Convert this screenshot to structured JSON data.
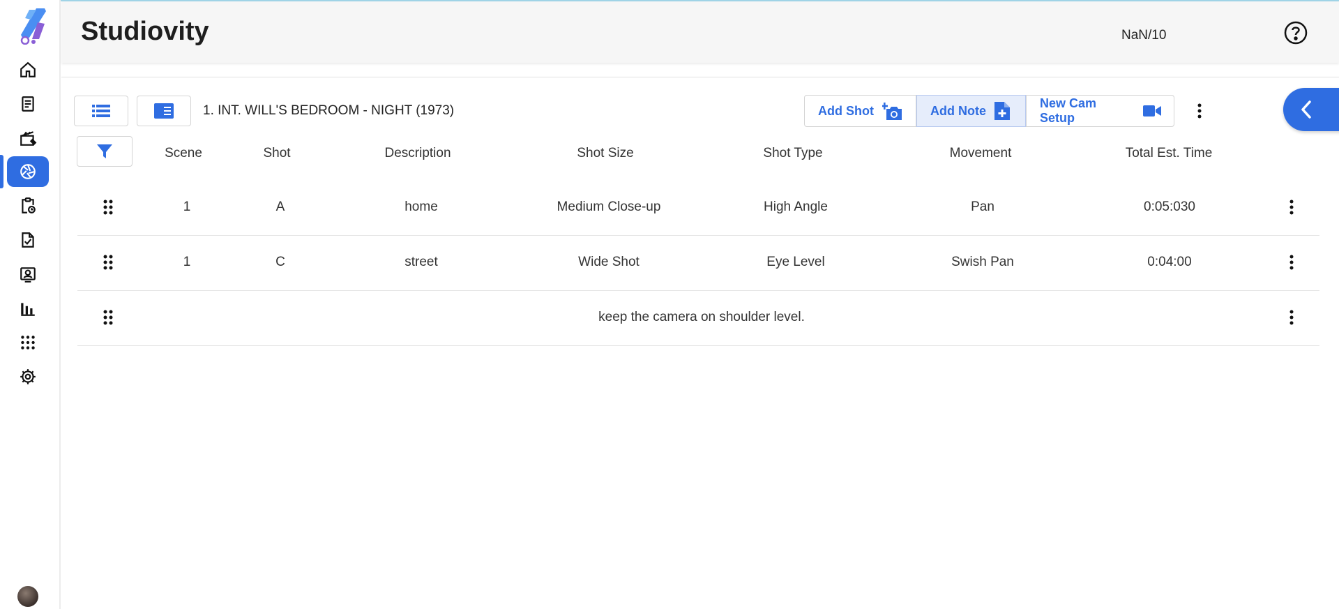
{
  "app": {
    "title": "Studiovity",
    "score": "NaN/10"
  },
  "sidebar": {
    "items": [
      {
        "name": "home"
      },
      {
        "name": "script"
      },
      {
        "name": "clapperboard"
      },
      {
        "name": "shot-list",
        "active": true
      },
      {
        "name": "schedule"
      },
      {
        "name": "tasks"
      },
      {
        "name": "contacts"
      },
      {
        "name": "reports"
      },
      {
        "name": "apps"
      },
      {
        "name": "settings"
      }
    ]
  },
  "toolbar": {
    "scene_title": "1. INT. WILL'S BEDROOM - NIGHT (1973)",
    "add_shot_label": "Add Shot",
    "add_note_label": "Add Note",
    "new_cam_setup_label": "New Cam Setup"
  },
  "table": {
    "headers": [
      "Scene",
      "Shot",
      "Description",
      "Shot Size",
      "Shot Type",
      "Movement",
      "Total Est. Time"
    ],
    "rows": [
      {
        "scene": "1",
        "shot": "A",
        "description": "home",
        "shot_size": "Medium Close-up",
        "shot_type": "High Angle",
        "movement": "Pan",
        "total_est_time": "0:05:030"
      },
      {
        "scene": "1",
        "shot": "C",
        "description": "street",
        "shot_size": "Wide Shot",
        "shot_type": "Eye Level",
        "movement": "Swish Pan",
        "total_est_time": "0:04:00"
      }
    ],
    "note": "keep the camera on shoulder level."
  },
  "colors": {
    "accent": "#2f6de1",
    "active_button_bg": "#e6edfb",
    "header_bg": "#f6f6f6"
  }
}
